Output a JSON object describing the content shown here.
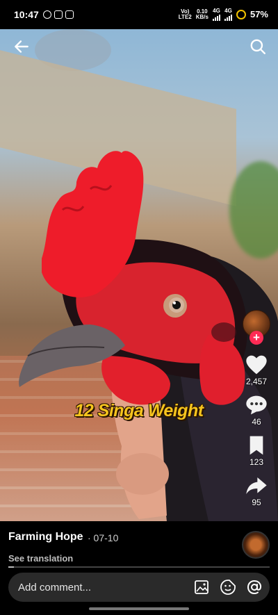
{
  "status_bar": {
    "time": "10:47",
    "net_label": "Vo)\nLTE2",
    "speed": "0.10",
    "speed_unit": "KB/s",
    "net_4g_a": "4G",
    "net_4g_b": "4G",
    "battery": "57%"
  },
  "video": {
    "caption": "12 Singa Weight"
  },
  "actions": {
    "likes": "2,457",
    "comments": "46",
    "saves": "123",
    "shares": "95"
  },
  "post": {
    "author": "Farming Hope",
    "date": "· 07-10",
    "see_translation": "See translation",
    "progress_fraction": 0.02
  },
  "comment_bar": {
    "placeholder": "Add comment..."
  },
  "colors": {
    "like_badge": "#ff2b55",
    "caption": "#f6c41e"
  }
}
